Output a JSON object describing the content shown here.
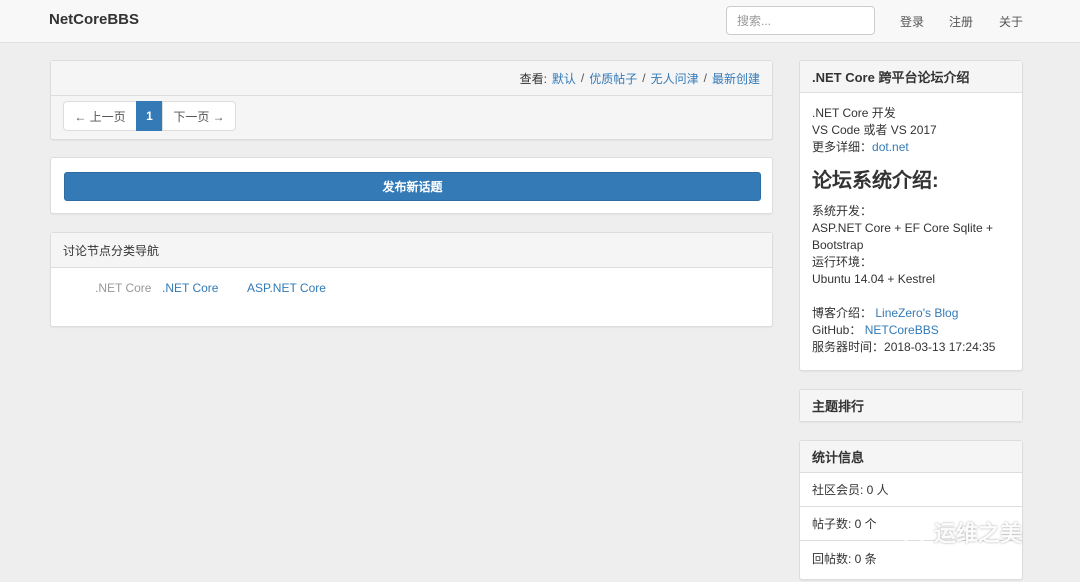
{
  "navbar": {
    "brand": "NetCoreBBS",
    "search_placeholder": "搜索...",
    "links": [
      "登录",
      "注册",
      "关于"
    ]
  },
  "filter": {
    "label": "查看:",
    "options": [
      "默认",
      "优质帖子",
      "无人问津",
      "最新创建"
    ],
    "separator": "/"
  },
  "pager": {
    "prev": "← 上一页",
    "current": "1",
    "next": "下一页 →"
  },
  "new_topic": {
    "label": "发布新话题"
  },
  "category": {
    "title": "讨论节点分类导航",
    "group": ".NET Core",
    "nodes": [
      ".NET Core",
      "ASP.NET Core"
    ]
  },
  "intro": {
    "title": ".NET Core 跨平台论坛介绍",
    "lines": [
      ".NET Core 开发",
      "VS Code 或者 VS 2017"
    ],
    "more_label": "更多详细：",
    "more_link": "dot.net",
    "heading": "论坛系统介绍:",
    "dev_label": "系统开发：",
    "dev_stack": "ASP.NET Core + EF Core Sqlite + Bootstrap",
    "env_label": "运行环境：",
    "env_value": "Ubuntu 14.04 + Kestrel",
    "blog_label": "博客介绍：",
    "blog_link": "LineZero's Blog",
    "github_label": "GitHub：",
    "github_link": "NETCoreBBS",
    "server_time_label": "服务器时间：",
    "server_time": "2018-03-13 17:24:35"
  },
  "ranking": {
    "title": "主题排行"
  },
  "stats": {
    "title": "统计信息",
    "rows": [
      "社区会员: 0 人",
      "帖子数: 0 个",
      "回帖数: 0 条"
    ]
  },
  "watermark": {
    "text": "运维之美"
  }
}
